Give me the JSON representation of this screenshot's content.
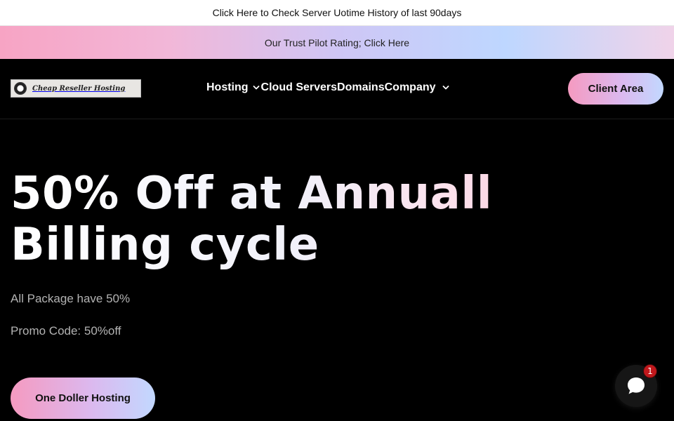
{
  "topbar": {
    "link": "Click Here to Check Server Uotime History of last 90days"
  },
  "trustbar": {
    "link": "Our Trust Pilot Rating; Click Here"
  },
  "header": {
    "logo_text": "Cheap Reseller Hosting",
    "nav": [
      {
        "label": "Hosting",
        "dropdown": true
      },
      {
        "label": "Cloud Servers",
        "dropdown": false
      },
      {
        "label": "Domains",
        "dropdown": false
      },
      {
        "label": "Company",
        "dropdown": true
      }
    ],
    "client_area": "Client Area"
  },
  "hero": {
    "title": "50% Off at Annuall Billing cycle",
    "line1": "All Package have 50%",
    "line2": "Promo Code: 50%off",
    "cta": "One Doller Hosting"
  },
  "chat": {
    "badge": "1"
  },
  "colors": {
    "accent_pink": "#f59ac0",
    "accent_lavender": "#dcb8ee",
    "accent_blue": "#c2d8ff",
    "background": "#000000",
    "badge": "#c0181c"
  },
  "icons": [
    "chevron-down-icon",
    "chat-icon",
    "logo-mark-icon"
  ]
}
